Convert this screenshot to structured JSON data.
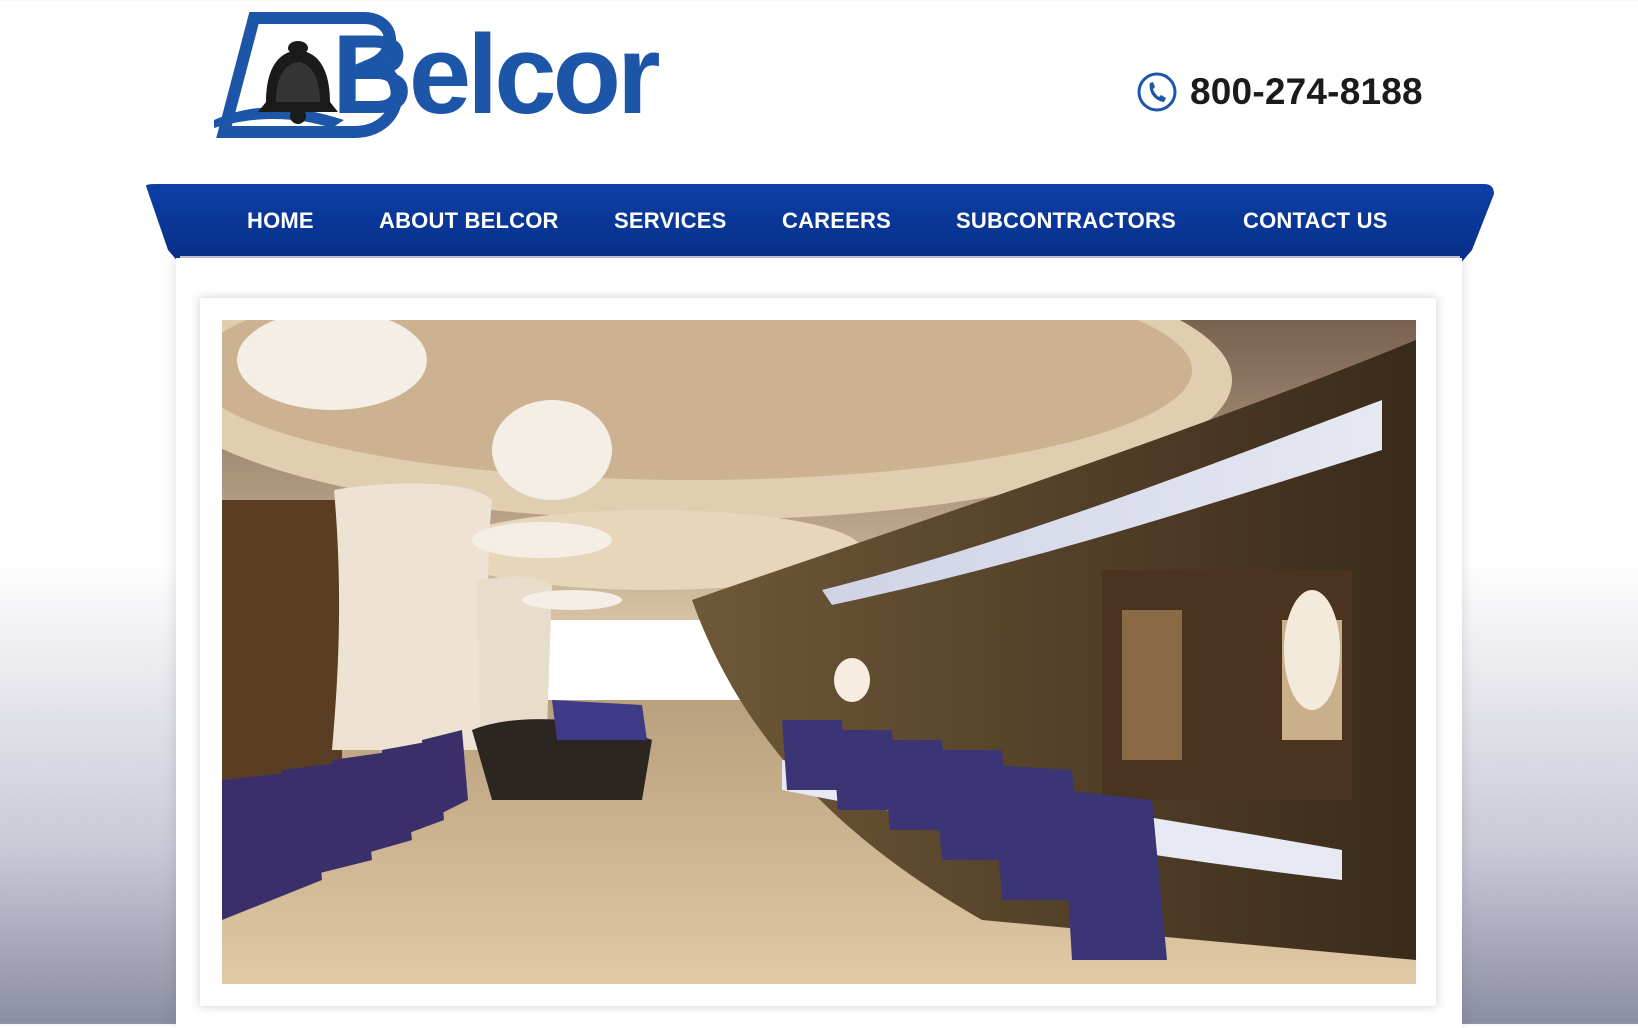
{
  "header": {
    "logo_text": "Belcor",
    "phone_icon": "phone-icon",
    "phone_number": "800-274-8188"
  },
  "nav": {
    "items": [
      {
        "label": "HOME"
      },
      {
        "label": "ABOUT BELCOR"
      },
      {
        "label": "SERVICES"
      },
      {
        "label": "CAREERS"
      },
      {
        "label": "SUBCONTRACTORS"
      },
      {
        "label": "CONTACT US"
      }
    ]
  },
  "hero": {
    "image": "restaurant-bar-interior-photo"
  },
  "colors": {
    "brand_blue": "#1d56a8",
    "nav_blue": "#0a3a99",
    "text_dark": "#1b1b1b"
  }
}
